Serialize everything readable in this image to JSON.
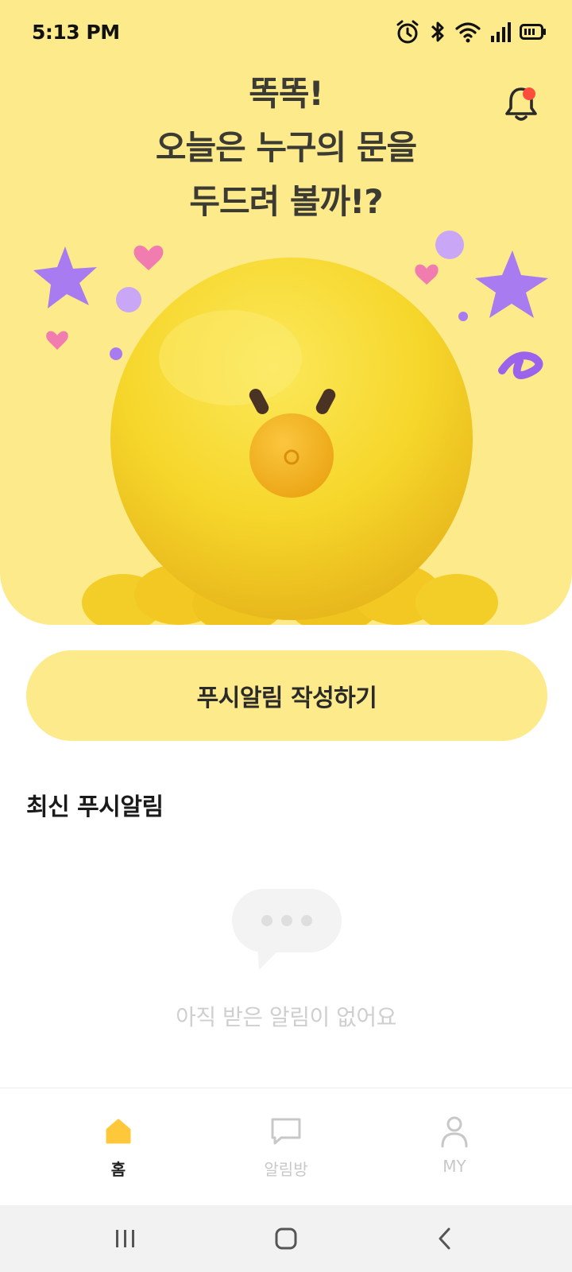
{
  "status_bar": {
    "time": "5:13 PM",
    "icons": [
      "alarm-icon",
      "bluetooth-icon",
      "wifi-icon",
      "signal-icon",
      "battery-icon"
    ]
  },
  "hero": {
    "headline_lines": [
      "똑똑!",
      "오늘은 누구의 문을",
      "두드려 볼까!?"
    ],
    "background_color": "#FDEA8A",
    "notification_icon": "bell-icon",
    "notification_dot_color": "#FF4D3D"
  },
  "compose_button": {
    "label": "푸시알림 작성하기"
  },
  "recent_section": {
    "title": "최신 푸시알림",
    "empty_icon": "chat-bubble-icon",
    "empty_text": "아직 받은 알림이 없어요"
  },
  "bottom_nav": {
    "items": [
      {
        "label": "홈",
        "icon": "home-icon",
        "active": true
      },
      {
        "label": "알림방",
        "icon": "chat-icon",
        "active": false
      },
      {
        "label": "MY",
        "icon": "person-icon",
        "active": false
      }
    ],
    "active_color": "#FFC83A"
  },
  "system_nav": {
    "buttons": [
      "recent-apps-icon",
      "home-circle-icon",
      "back-icon"
    ]
  }
}
